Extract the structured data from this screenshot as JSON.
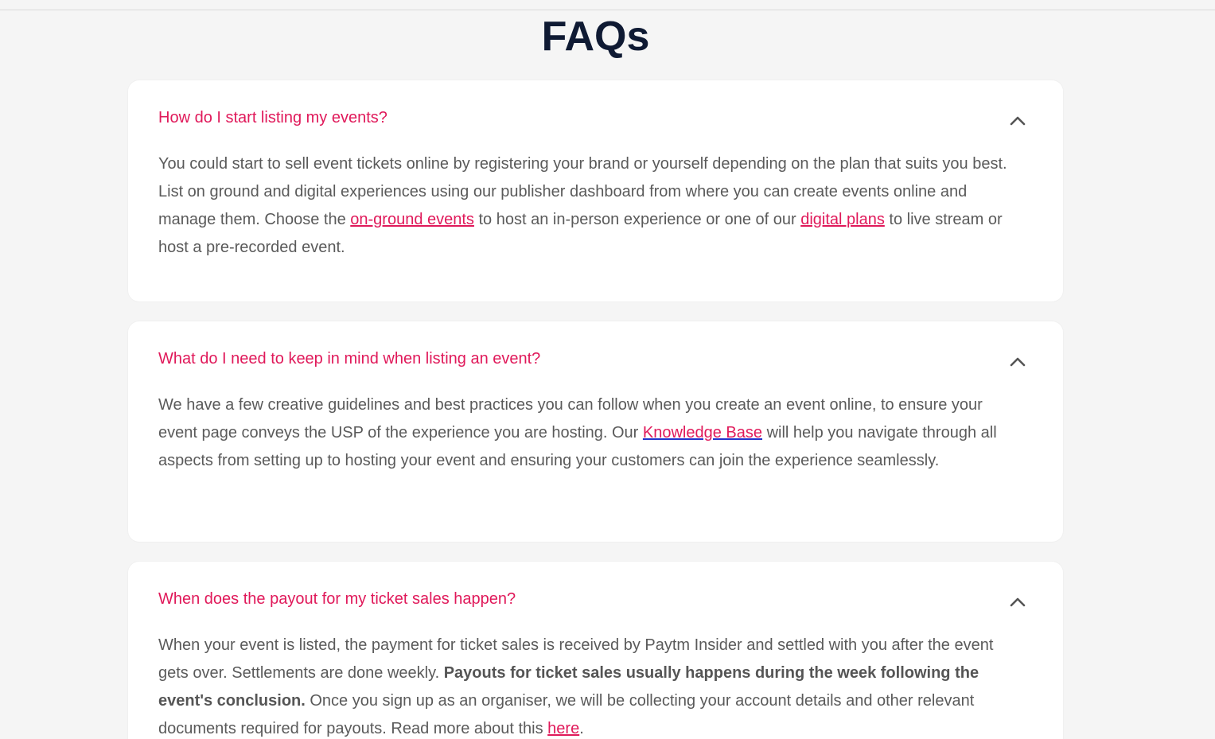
{
  "page": {
    "title": "FAQs"
  },
  "faqs": [
    {
      "question": "How do I start listing my events?",
      "answer": {
        "p1": "You could start to sell event tickets online by registering your brand or yourself depending on the plan that suits you best. List on ground and digital experiences using our publisher dashboard from where you can create events online and manage them. Choose the ",
        "link1": "on-ground events",
        "p2": " to host an in-person experience or one of our ",
        "link2": "digital plans",
        "p3": " to live stream or host a pre-recorded event."
      },
      "toggle_icon": "chevron-up-icon"
    },
    {
      "question": "What do I need to keep in mind when listing an event?",
      "answer": {
        "p1": "We have a few creative guidelines and best practices you can follow when you create an event online, to ensure your event page conveys the USP of the experience you are hosting. Our ",
        "link1": "Knowledge Base",
        "p2": " will help you navigate through all aspects from setting up to hosting your event and ensuring your customers can join the experience seamlessly."
      },
      "toggle_icon": "chevron-up-icon"
    },
    {
      "question": "When does the payout for my ticket sales happen?",
      "answer": {
        "p1": "When your event is listed, the payment for ticket sales is received by Paytm Insider and settled with you after the event gets over. Settlements are done weekly. ",
        "bold": "Payouts for ticket sales usually happens during the week following the event's conclusion.",
        "p2": " Once you sign up as an organiser, we will be collecting your account details and other relevant documents required for payouts. Read more about this ",
        "link1": "here",
        "p3": "."
      },
      "toggle_icon": "chevron-up-icon"
    }
  ],
  "colors": {
    "accent": "#e0195a",
    "title": "#0f1a33",
    "body_text": "#5a5a5a",
    "background": "#f5f5f5",
    "card": "#ffffff"
  }
}
